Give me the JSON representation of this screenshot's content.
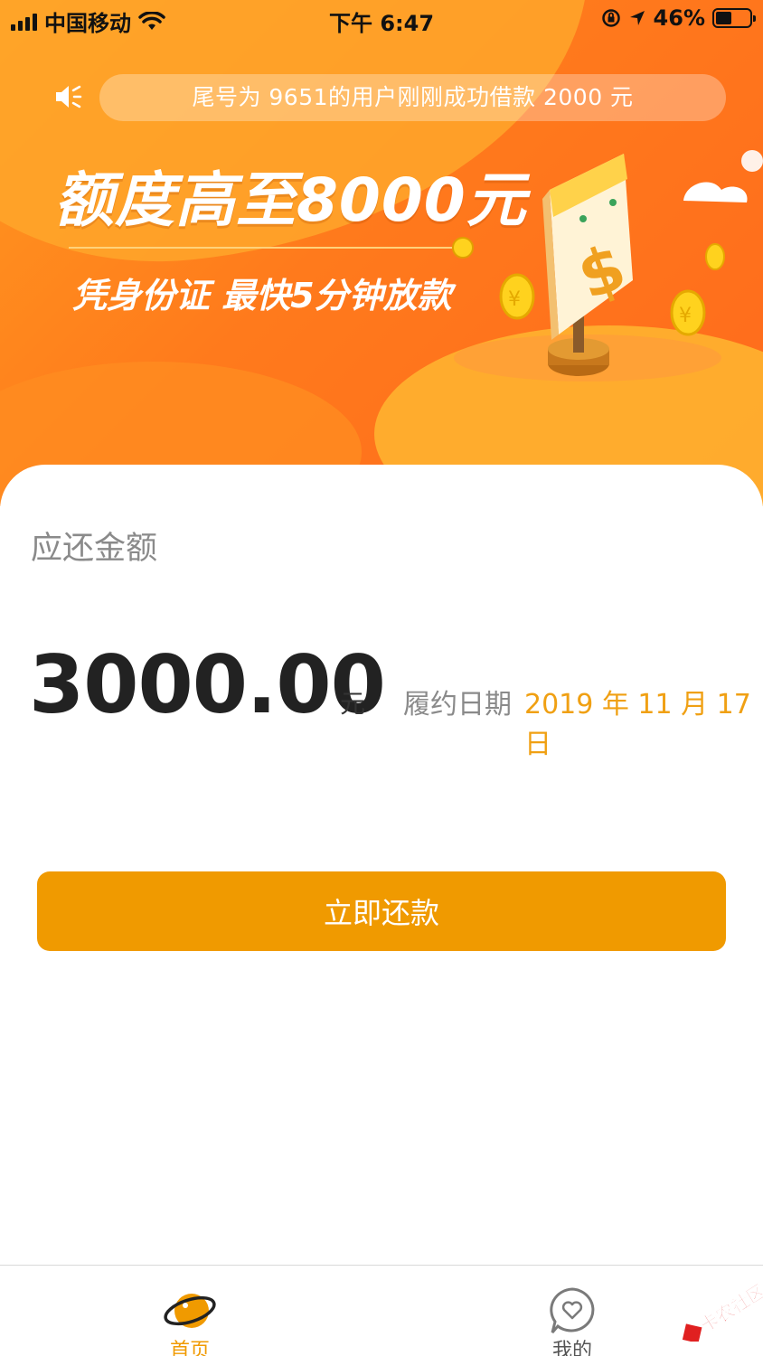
{
  "status_bar": {
    "carrier": "中国移动",
    "time": "下午 6:47",
    "battery_percent": "46%"
  },
  "banner": {
    "notice": "尾号为 9651的用户刚刚成功借款 2000 元",
    "headline": "额度高至8000元",
    "subline": "凭身份证 最快5分钟放款"
  },
  "repayment": {
    "label": "应还金额",
    "amount": "3000.00",
    "unit": "元",
    "due_date_label": "履约日期",
    "due_date": "2019 年 11 月 17 日"
  },
  "actions": {
    "repay_button": "立即还款"
  },
  "tabbar": {
    "items": [
      {
        "label": "首页",
        "active": true,
        "icon": "planet-icon"
      },
      {
        "label": "我的",
        "active": false,
        "icon": "heart-bubble-icon"
      }
    ]
  },
  "watermark": {
    "text": "卡农社区"
  },
  "colors": {
    "accent": "#f09a00",
    "banner_orange": "#ff7a1c",
    "date_highlight": "#f0a013"
  }
}
